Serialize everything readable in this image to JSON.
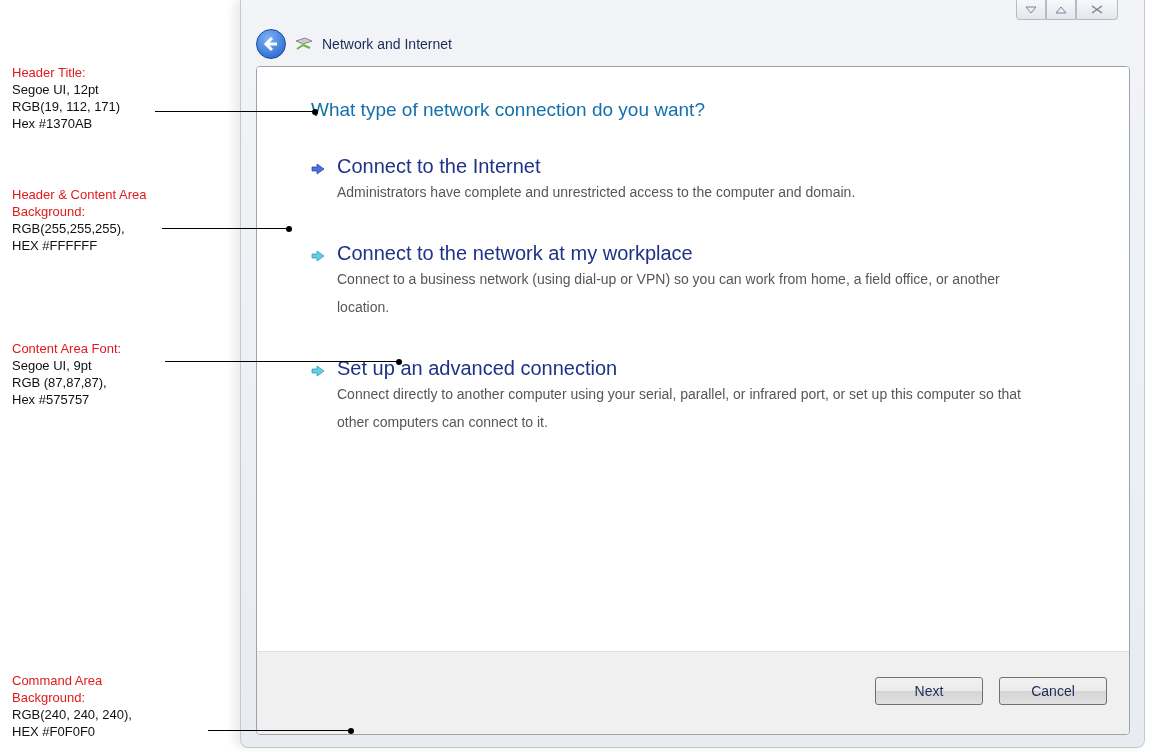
{
  "annotations": [
    {
      "title": "Header Title:",
      "lines": [
        "Segoe UI, 12pt",
        "RGB(19, 112, 171)",
        "Hex #1370AB"
      ]
    },
    {
      "title": "Header & Content Area Background:",
      "lines": [
        "RGB(255,255,255),",
        "HEX #FFFFFF"
      ]
    },
    {
      "title": "Content Area Font:",
      "lines": [
        "Segoe UI, 9pt",
        "RGB (87,87,87),",
        "Hex #575757"
      ]
    },
    {
      "title": "Command Area Background:",
      "lines": [
        "RGB(240, 240, 240),",
        "HEX #F0F0F0"
      ]
    }
  ],
  "window": {
    "breadcrumb": "Network and Internet"
  },
  "heading": "What type of network connection do you want?",
  "options": [
    {
      "title": "Connect to the Internet",
      "description": "Administrators have complete and unrestricted access to the computer and domain.",
      "selected": true
    },
    {
      "title": "Connect to the network at my workplace",
      "description": "Connect to a business network (using dial-up or VPN) so you can work from home, a field office, or another location.",
      "selected": false
    },
    {
      "title": "Set up an advanced connection",
      "description": "Connect directly to another computer using your serial, parallel, or infrared port, or set up this computer so that other computers can connect to it.",
      "selected": false
    }
  ],
  "buttons": [
    "Next",
    "Cancel"
  ]
}
